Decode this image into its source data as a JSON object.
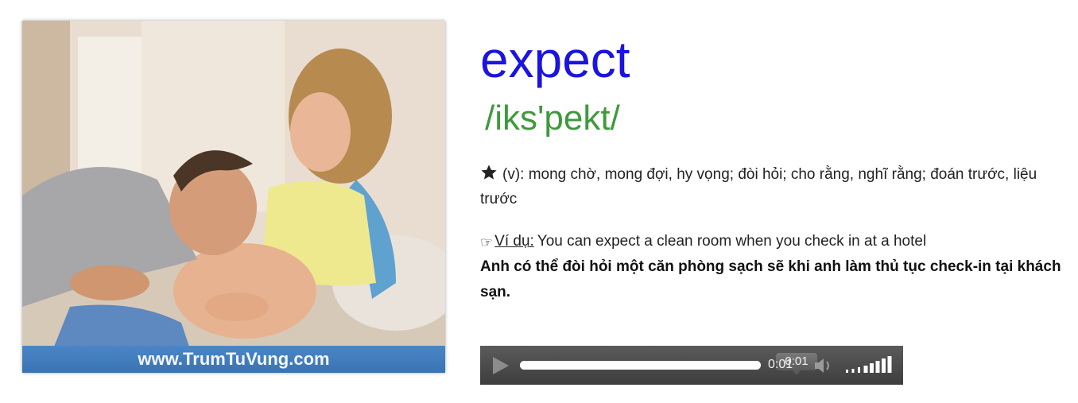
{
  "image": {
    "description_icon": "couple-photo-image",
    "watermark": "www.TrumTuVung.com"
  },
  "entry": {
    "word": "expect",
    "pronunciation": "/iks'pekt/",
    "meaning_icon": "star-icon",
    "meaning": "(v): mong chờ, mong đợi, hy vọng; đòi hỏi; cho rằng, nghĩ rằng; đoán trước, liệu trước",
    "example_icon": "pointing-hand-icon",
    "example_label": "Ví dụ:",
    "example_sentence": "You can expect a clean room when you check in at a hotel",
    "example_translation": "Anh có thể đòi hỏi một căn phòng sạch sẽ khi anh làm thủ tục check-in tại khách sạn."
  },
  "player": {
    "play_icon": "play-icon",
    "tooltip_time": "0:01",
    "current_time": "0:01",
    "progress": 1.0,
    "volume_icon": "speaker-icon",
    "volume_bars_icon": "volume-level-icon",
    "volume_level": 1.0
  },
  "colors": {
    "word": "#1b14e0",
    "pronunciation": "#3f9a3c",
    "watermark_band": "#3a73b3",
    "player_bg": "#4a4a4a"
  }
}
